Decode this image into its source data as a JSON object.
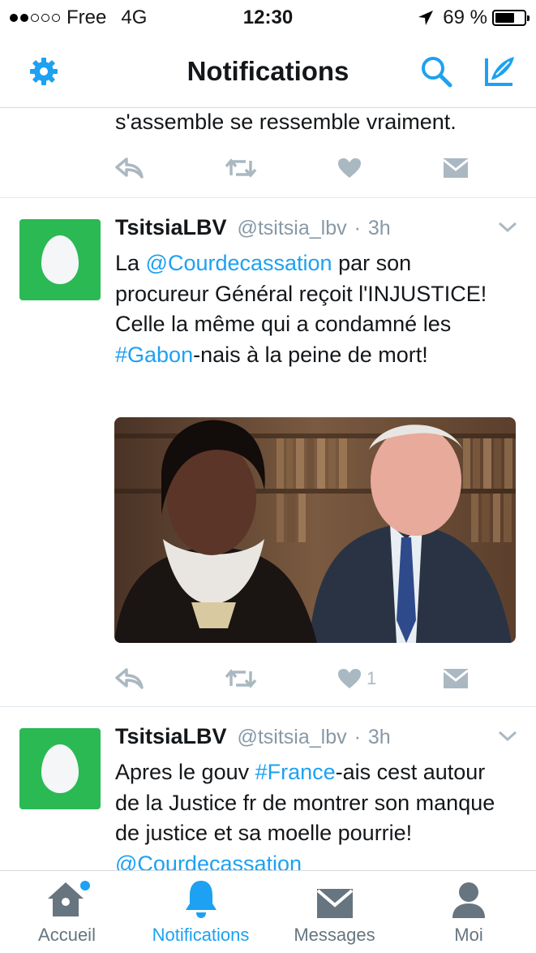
{
  "status_bar": {
    "carrier": "Free",
    "network": "4G",
    "time": "12:30",
    "battery_percent": "69 %",
    "battery_level": 0.69,
    "signal_bars_filled": 2,
    "signal_bars_total": 5
  },
  "nav": {
    "title": "Notifications",
    "left_icon": "gear-icon",
    "right_icons": [
      "search-icon",
      "compose-icon"
    ]
  },
  "colors": {
    "accent": "#1da1f2",
    "avatar_bg": "#2bb954",
    "action_gray": "#aab8c2"
  },
  "partial_tweet": {
    "text_tail": "s'assemble se ressemble vraiment."
  },
  "tweets": [
    {
      "name": "TsitsiaLBV",
      "handle": "@tsitsia_lbv",
      "sep": "·",
      "time": "3h",
      "text": {
        "t1": "La ",
        "link1": "@Courdecassation",
        "t2": " par son procureur Général reçoit l'INJUSTICE! Celle la même qui a condamné les ",
        "link2": "#Gabon",
        "t3": "-nais à la peine de mort!"
      },
      "like_count": "1"
    },
    {
      "name": "TsitsiaLBV",
      "handle": "@tsitsia_lbv",
      "sep": "·",
      "time": "3h",
      "text": {
        "t1": "Apres le gouv ",
        "link1": "#France",
        "t2": "-ais cest autour de la Justice fr de montrer son manque de justice et sa moelle pourrie! ",
        "link2": "@Courdecassation",
        "t3": ""
      }
    }
  ],
  "tabs": [
    {
      "label": "Accueil",
      "icon": "home-icon",
      "active": false
    },
    {
      "label": "Notifications",
      "icon": "bell-icon",
      "active": true
    },
    {
      "label": "Messages",
      "icon": "envelope-icon",
      "active": false
    },
    {
      "label": "Moi",
      "icon": "person-icon",
      "active": false
    }
  ]
}
